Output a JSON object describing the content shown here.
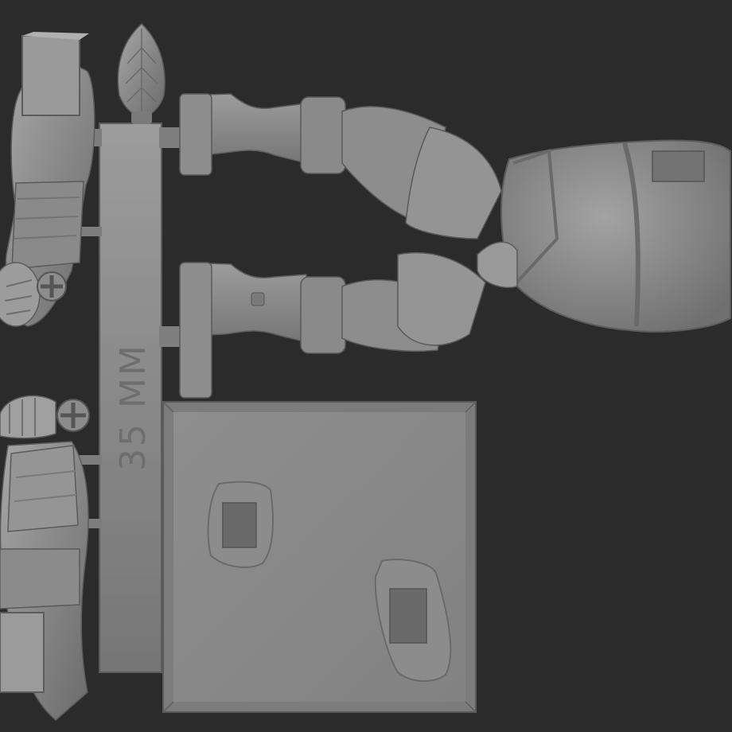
{
  "scene": {
    "background_color": "#2b2b2b",
    "model_color": "#8a8a8a",
    "sprue_label": "35 MM",
    "description_parts": [
      "legs-and-torso",
      "base",
      "left-arm",
      "right-arm",
      "feather-plume",
      "sprue-bar"
    ]
  }
}
